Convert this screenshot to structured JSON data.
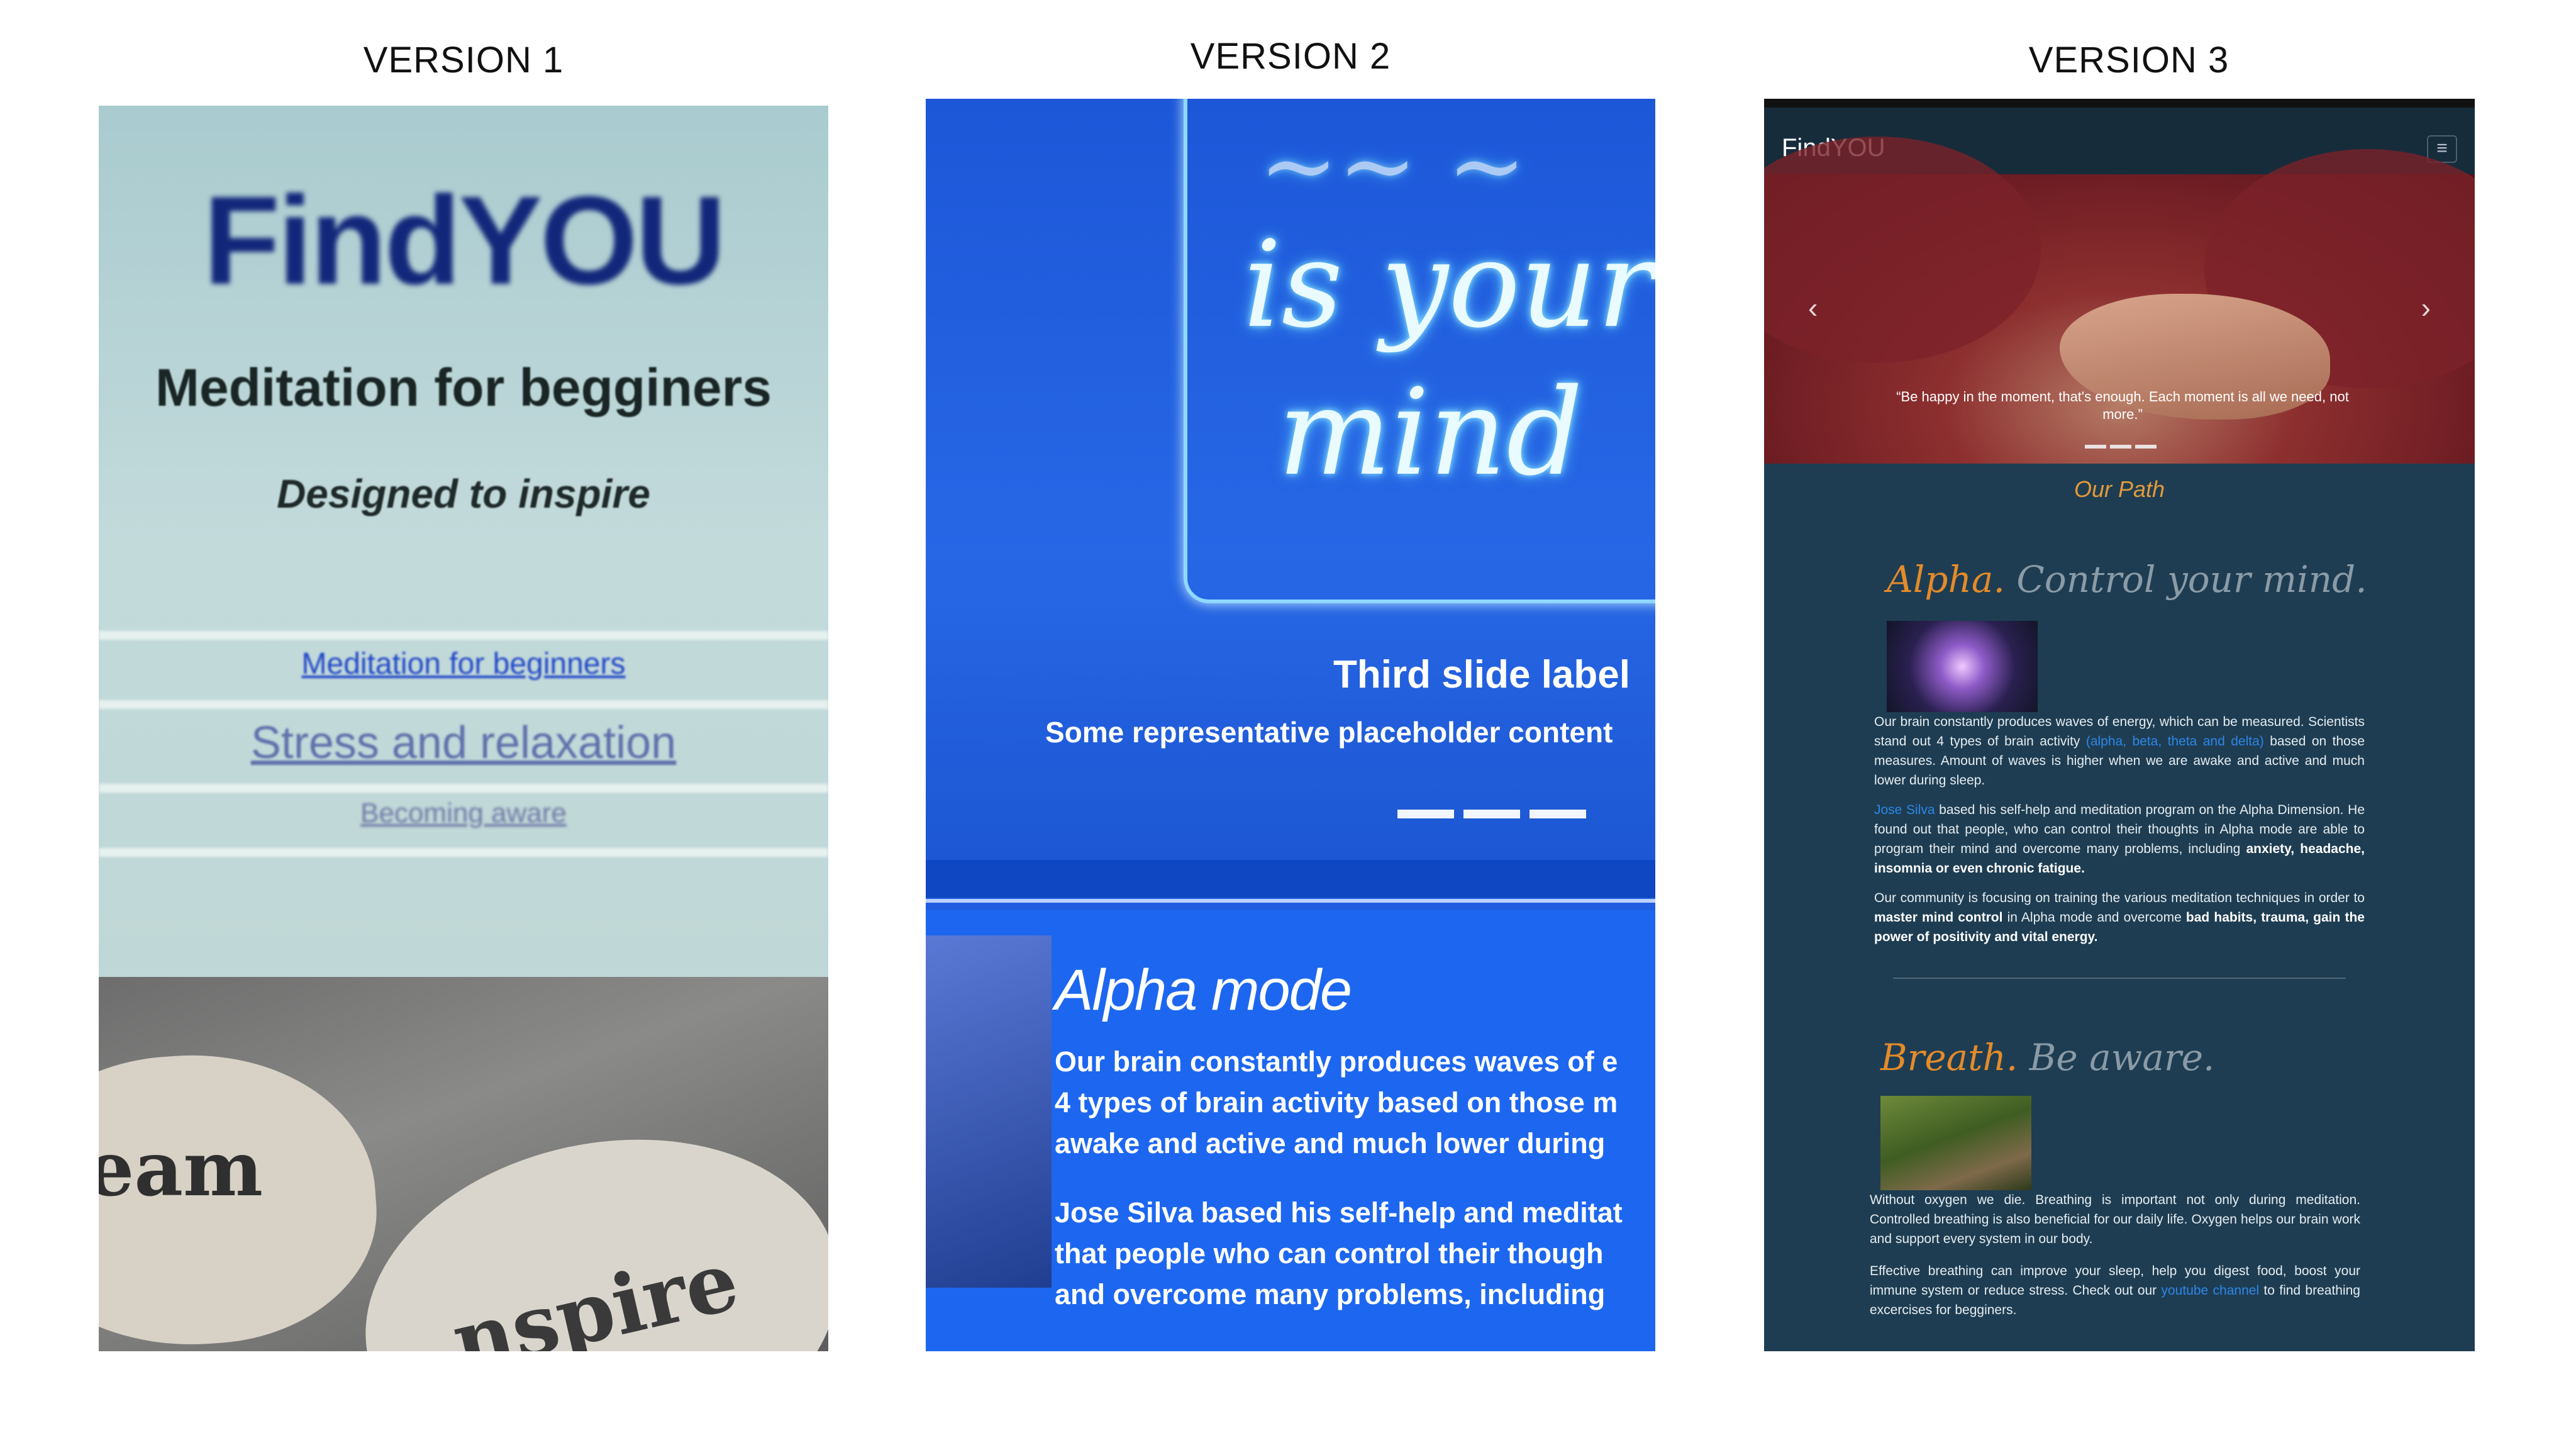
{
  "versions": {
    "v1": {
      "title": "VERSION 1"
    },
    "v2": {
      "title": "VERSION 2"
    },
    "v3": {
      "title": "VERSION 3"
    }
  },
  "version1": {
    "brand": "FindYOU",
    "heading": "Meditation for begginers",
    "subheading": "Designed to inspire",
    "nav_links": [
      "Meditation for beginners",
      "Stress and relaxation",
      "Becoming aware"
    ],
    "stone_words": [
      "eam",
      "nspire"
    ]
  },
  "version2": {
    "neon_lines": [
      "is your",
      "mind"
    ],
    "slide_title": "Third slide label",
    "slide_text": "Some representative placeholder content",
    "section_heading": "Alpha mode",
    "paragraph_lines": [
      "Our brain constantly produces waves of e",
      "4 types of brain activity based on those m",
      "awake and active and much lower during",
      "Jose Silva based his self-help and meditat",
      "that people who can control their though",
      "and overcome many problems, including"
    ]
  },
  "version3": {
    "brand": "FindYOU",
    "menu_icon": "≡",
    "carousel": {
      "prev_icon": "‹",
      "next_icon": "›",
      "caption": "“Be happy in the moment, that's enough. Each moment is all we need, not more.”"
    },
    "our_path": "Our Path",
    "alpha": {
      "title_accent": "Alpha.",
      "title_rest": "Control your mind.",
      "p1_a": "Our brain constantly produces waves of energy, which can be measured. Scientists stand out 4 types of brain activity ",
      "p1_link": "(alpha, beta, theta and delta)",
      "p1_b": " based on those measures. Amount of waves is higher when we are awake and active and much lower during sleep.",
      "p2_link": "Jose Silva",
      "p2_a": " based his self-help and meditation program on the Alpha Dimension. He found out that people, who can control their thoughts in Alpha mode are able to program their mind and overcome many problems, including ",
      "p2_bold": "anxiety, headache, insomnia or even chronic fatigue.",
      "p3_a": "Our community is focusing on training the various meditation techniques in order to ",
      "p3_bold1": "master mind control",
      "p3_b": " in Alpha mode and overcome ",
      "p3_bold2": "bad habits, trauma, gain the power of positivity and vital energy."
    },
    "breath": {
      "title_accent": "Breath.",
      "title_rest": "Be aware.",
      "p1": "Without oxygen we die. Breathing is important not only during meditation. Controlled breathing is also beneficial for our daily life. Oxygen helps our brain work and support every system in our body.",
      "p2_a": "Effective breathing can improve your sleep, help you digest food, boost your immune system or reduce stress. Check out our ",
      "p2_link": "youtube channel",
      "p2_b": " to find breathing excercises for begginers."
    }
  }
}
